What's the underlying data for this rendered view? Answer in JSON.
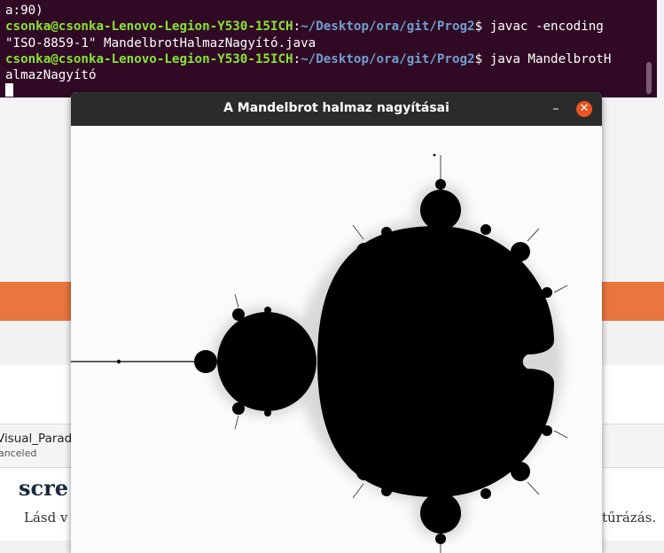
{
  "terminal": {
    "line1": "a:90)",
    "prompt1_user": "csonka@csonka-Lenovo-Legion-Y530-15ICH",
    "prompt1_path": "~/Desktop/ora/git/Prog2",
    "prompt1_cmd": "$ javac -encoding",
    "line3": "\"ISO-8859-1\" MandelbrotHalmazNagyító.java",
    "prompt2_user": "csonka@csonka-Lenovo-Legion-Y530-15ICH",
    "prompt2_path": "~/Desktop/ora/git/Prog2",
    "prompt2_cmd": "$ java MandelbrotH",
    "line5": "almazNagyító"
  },
  "background": {
    "download_name": "Visual_Parad",
    "download_status": "anceled",
    "heading": "scre",
    "text_left": "Lásd v",
    "text_right": "tűrázás."
  },
  "window": {
    "title": "A Mandelbrot halmaz nagyításai",
    "minimize_glyph": "–",
    "close_glyph": "✕",
    "close_color": "#e95420"
  }
}
